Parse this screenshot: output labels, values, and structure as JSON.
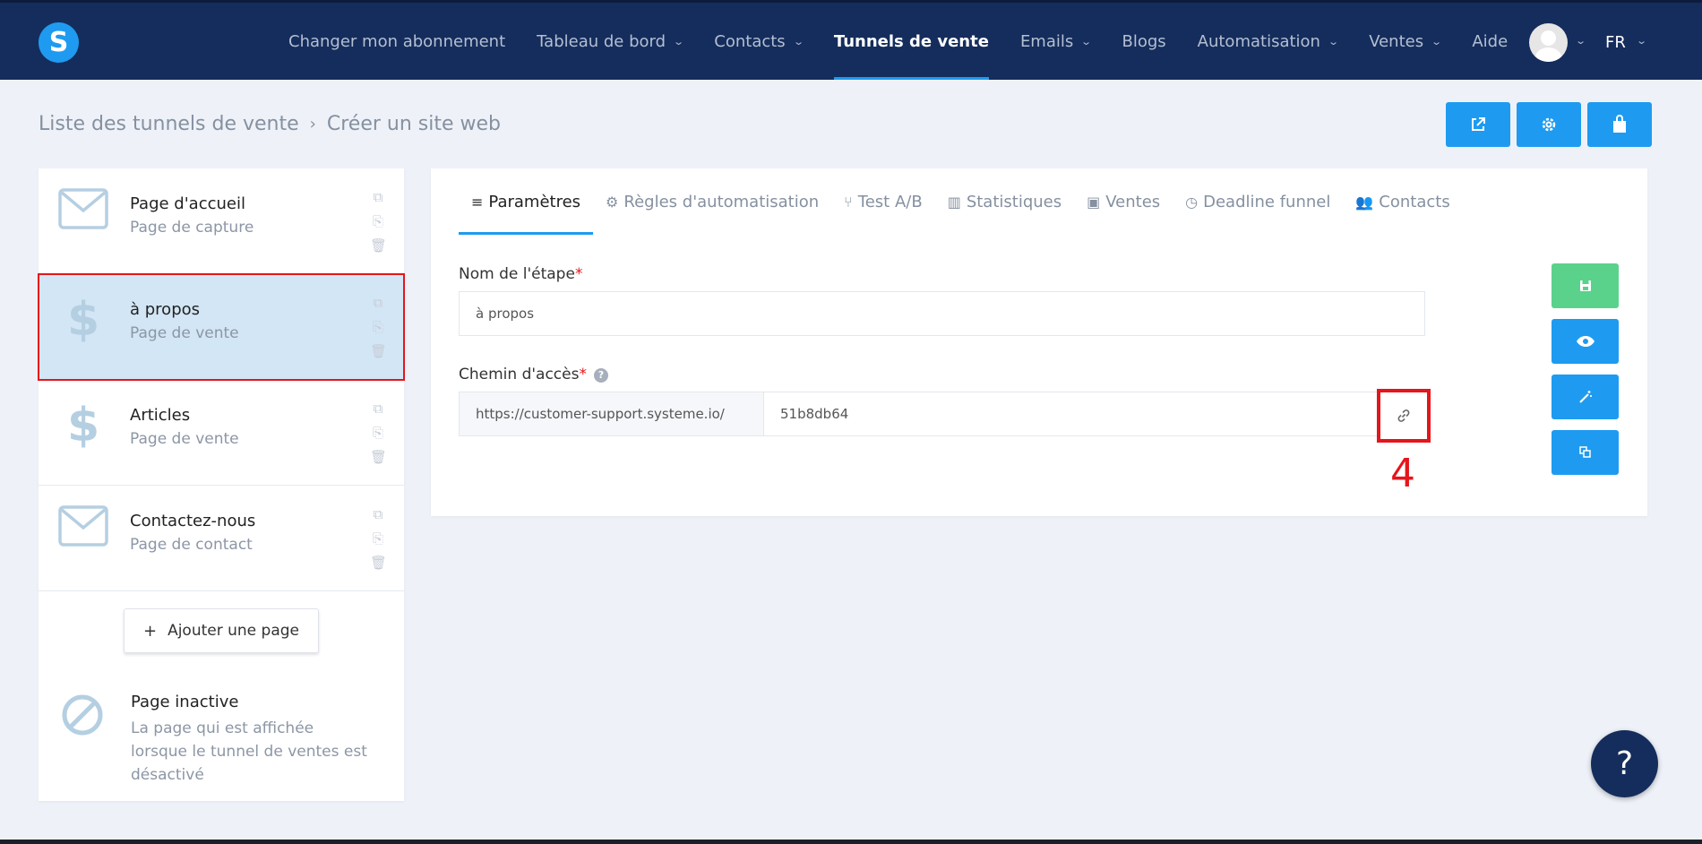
{
  "app": {
    "logo_letter": "S",
    "brand_color": "#1e9bf0",
    "nav_bg": "#152d5c"
  },
  "nav": {
    "items": [
      {
        "label": "Changer mon abonnement",
        "has_dropdown": false,
        "active": false
      },
      {
        "label": "Tableau de bord",
        "has_dropdown": true,
        "active": false
      },
      {
        "label": "Contacts",
        "has_dropdown": true,
        "active": false
      },
      {
        "label": "Tunnels de vente",
        "has_dropdown": false,
        "active": true
      },
      {
        "label": "Emails",
        "has_dropdown": true,
        "active": false
      },
      {
        "label": "Blogs",
        "has_dropdown": false,
        "active": false
      },
      {
        "label": "Automatisation",
        "has_dropdown": true,
        "active": false
      },
      {
        "label": "Ventes",
        "has_dropdown": true,
        "active": false
      },
      {
        "label": "Aide",
        "has_dropdown": false,
        "active": false
      }
    ],
    "language": "FR"
  },
  "breadcrumb": {
    "parent": "Liste des tunnels de vente",
    "separator": "›",
    "current": "Créer un site web"
  },
  "top_actions": [
    {
      "name": "external-link-icon"
    },
    {
      "name": "settings-icon"
    },
    {
      "name": "shop-icon"
    }
  ],
  "pages": [
    {
      "title": "Page d'accueil",
      "subtitle": "Page de capture",
      "icon": "envelope-icon",
      "selected": false
    },
    {
      "title": "à propos",
      "subtitle": "Page de vente",
      "icon": "dollar-icon",
      "selected": true
    },
    {
      "title": "Articles",
      "subtitle": "Page de vente",
      "icon": "dollar-icon",
      "selected": false
    },
    {
      "title": "Contactez-nous",
      "subtitle": "Page de contact",
      "icon": "envelope-icon",
      "selected": false
    }
  ],
  "add_page_label": "Ajouter une page",
  "inactive": {
    "title": "Page inactive",
    "description": "La page qui est affichée lorsque le tunnel de ventes est désactivé"
  },
  "tabs": [
    {
      "label": "Paramètres",
      "icon": "≡",
      "active": true
    },
    {
      "label": "Règles d'automatisation",
      "icon": "⚙",
      "active": false
    },
    {
      "label": "Test A/B",
      "icon": "⑂",
      "active": false
    },
    {
      "label": "Statistiques",
      "icon": "▥",
      "active": false
    },
    {
      "label": "Ventes",
      "icon": "▣",
      "active": false
    },
    {
      "label": "Deadline funnel",
      "icon": "◷",
      "active": false
    },
    {
      "label": "Contacts",
      "icon": "👥",
      "active": false
    }
  ],
  "form": {
    "step_name_label": "Nom de l'étape",
    "step_name_value": "à propos",
    "path_label": "Chemin d'accès",
    "path_prefix": "https://customer-support.systeme.io/",
    "path_value": "51b8db64",
    "required_mark": "*"
  },
  "annotation": "4",
  "help_fab": "?"
}
